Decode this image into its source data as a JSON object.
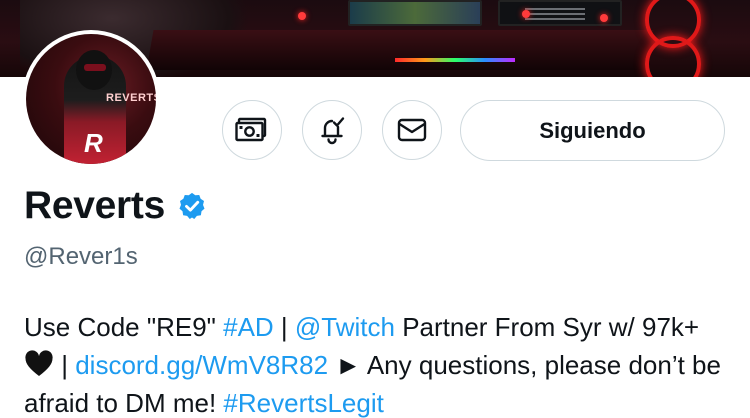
{
  "profile": {
    "display_name": "Reverts",
    "handle": "@Rever1s",
    "verified": true,
    "avatar_tag": "REVERTS",
    "avatar_logo": "R"
  },
  "actions": {
    "tip_icon": "money-icon",
    "notify_icon": "bell-check-icon",
    "message_icon": "mail-icon",
    "follow_label": "Siguiendo"
  },
  "bio": {
    "t1": "Use Code \"RE9\" ",
    "hashtag_ad": "#AD",
    "t2": " | ",
    "mention_twitch": "@Twitch",
    "t3": " Partner From Syr w/ 97k+ ",
    "heart_icon": "black-heart-icon",
    "t4": " | ",
    "discord_link": "discord.gg/WmV8R82",
    "t5": " ► Any questions, please don’t be afraid to DM me! ",
    "hashtag_legit": "#RevertsLegit"
  },
  "colors": {
    "link": "#1d9bf0",
    "verified": "#1d9bf0",
    "secondary_text": "#536471",
    "border": "#cfd9de"
  }
}
